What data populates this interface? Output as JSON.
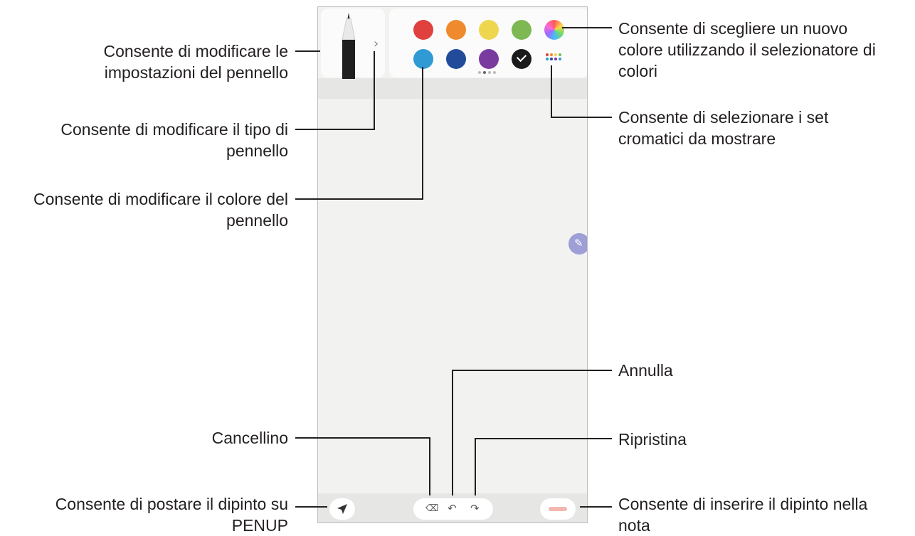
{
  "callouts": {
    "brush_settings": [
      "Consente di modificare le",
      "impostazioni del pennello"
    ],
    "brush_type": [
      "Consente di modificare il tipo di",
      "pennello"
    ],
    "brush_color": [
      "Consente di modificare il colore del",
      "pennello"
    ],
    "eraser": [
      "Cancellino"
    ],
    "post_penup": [
      "Consente di postare il dipinto su",
      "PENUP"
    ],
    "color_picker": [
      "Consente di scegliere un nuovo",
      "colore utilizzando il selezionatore di",
      "colori"
    ],
    "color_sets": [
      "Consente di selezionare i set",
      "cromatici da mostrare"
    ],
    "undo": [
      "Annulla"
    ],
    "redo": [
      "Ripristina"
    ],
    "insert": [
      "Consente di inserire il dipinto nella",
      "nota"
    ]
  },
  "palette": {
    "row1": [
      "#e0413e",
      "#ef8a2f",
      "#eed64f",
      "#7db853",
      "gradient"
    ],
    "row2": [
      "#2f9ad4",
      "#224b9a",
      "#7a3b9e",
      "#1b1b1b"
    ],
    "selected_index_row2": 3
  },
  "icons": {
    "brush": "brush-icon",
    "chevron": "chevron-right-icon",
    "color_picker": "color-wheel-icon",
    "color_sets": "palette-grid-icon",
    "eraser": "eraser-icon",
    "undo": "undo-icon",
    "redo": "redo-icon",
    "send": "send-icon",
    "edit_fab": "pencil-icon"
  }
}
